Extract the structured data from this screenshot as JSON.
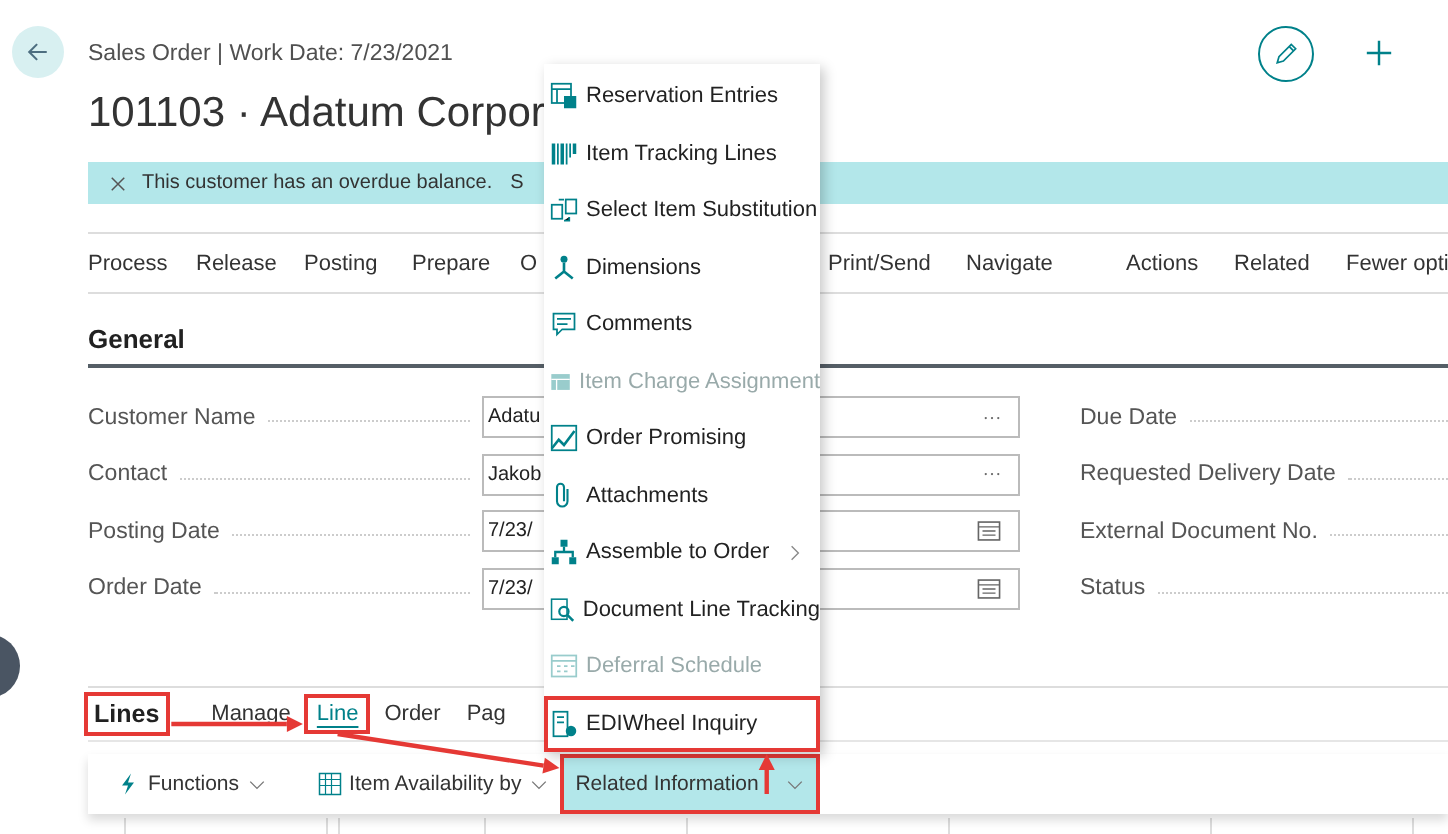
{
  "header": {
    "breadcrumb": "Sales Order | Work Date: 7/23/2021",
    "title": "101103 · Adatum Corpor"
  },
  "banner": {
    "message": "This customer has an overdue balance.",
    "link": "S"
  },
  "action_groups": [
    [
      "Process",
      "Release",
      "Posting",
      "Prepare",
      "O",
      "Print/Send",
      "Navigate"
    ],
    [
      "Actions",
      "Related",
      "Fewer opti"
    ]
  ],
  "general": {
    "title": "General",
    "left_fields": [
      {
        "label": "Customer Name",
        "value": "Adatu",
        "kind": "lookup"
      },
      {
        "label": "Contact",
        "value": "Jakob",
        "kind": "lookup"
      },
      {
        "label": "Posting Date",
        "value": "7/23/",
        "kind": "date"
      },
      {
        "label": "Order Date",
        "value": "7/23/",
        "kind": "date"
      }
    ],
    "right_fields": [
      {
        "label": "Due Date"
      },
      {
        "label": "Requested Delivery Date"
      },
      {
        "label": "External Document No."
      },
      {
        "label": "Status"
      }
    ]
  },
  "lines": {
    "title": "Lines",
    "highlighted": true,
    "tabs": [
      {
        "label": "Manage",
        "selected": false,
        "highlighted": false
      },
      {
        "label": "Line",
        "selected": true,
        "highlighted": true
      },
      {
        "label": "Order",
        "selected": false,
        "highlighted": false
      },
      {
        "label": "Pag",
        "selected": false,
        "highlighted": false
      }
    ],
    "toolbar": [
      {
        "label": "Functions",
        "selected": false,
        "highlighted": false
      },
      {
        "label": "Item Availability by",
        "selected": false,
        "highlighted": false
      },
      {
        "label": "Related Information",
        "selected": true,
        "highlighted": true
      }
    ]
  },
  "menu": {
    "items": [
      {
        "label": "Reservation Entries",
        "disabled": false,
        "submenu": false,
        "highlighted": false
      },
      {
        "label": "Item Tracking Lines",
        "disabled": false,
        "submenu": false,
        "highlighted": false
      },
      {
        "label": "Select Item Substitution",
        "disabled": false,
        "submenu": false,
        "highlighted": false
      },
      {
        "label": "Dimensions",
        "disabled": false,
        "submenu": false,
        "highlighted": false
      },
      {
        "label": "Comments",
        "disabled": false,
        "submenu": false,
        "highlighted": false
      },
      {
        "label": "Item Charge Assignment",
        "disabled": true,
        "submenu": false,
        "highlighted": false
      },
      {
        "label": "Order Promising",
        "disabled": false,
        "submenu": false,
        "highlighted": false
      },
      {
        "label": "Attachments",
        "disabled": false,
        "submenu": false,
        "highlighted": false
      },
      {
        "label": "Assemble to Order",
        "disabled": false,
        "submenu": true,
        "highlighted": false
      },
      {
        "label": "Document Line Tracking",
        "disabled": false,
        "submenu": false,
        "highlighted": false
      },
      {
        "label": "Deferral Schedule",
        "disabled": true,
        "submenu": false,
        "highlighted": false
      },
      {
        "label": "EDIWheel Inquiry",
        "disabled": false,
        "submenu": false,
        "highlighted": true
      }
    ]
  }
}
